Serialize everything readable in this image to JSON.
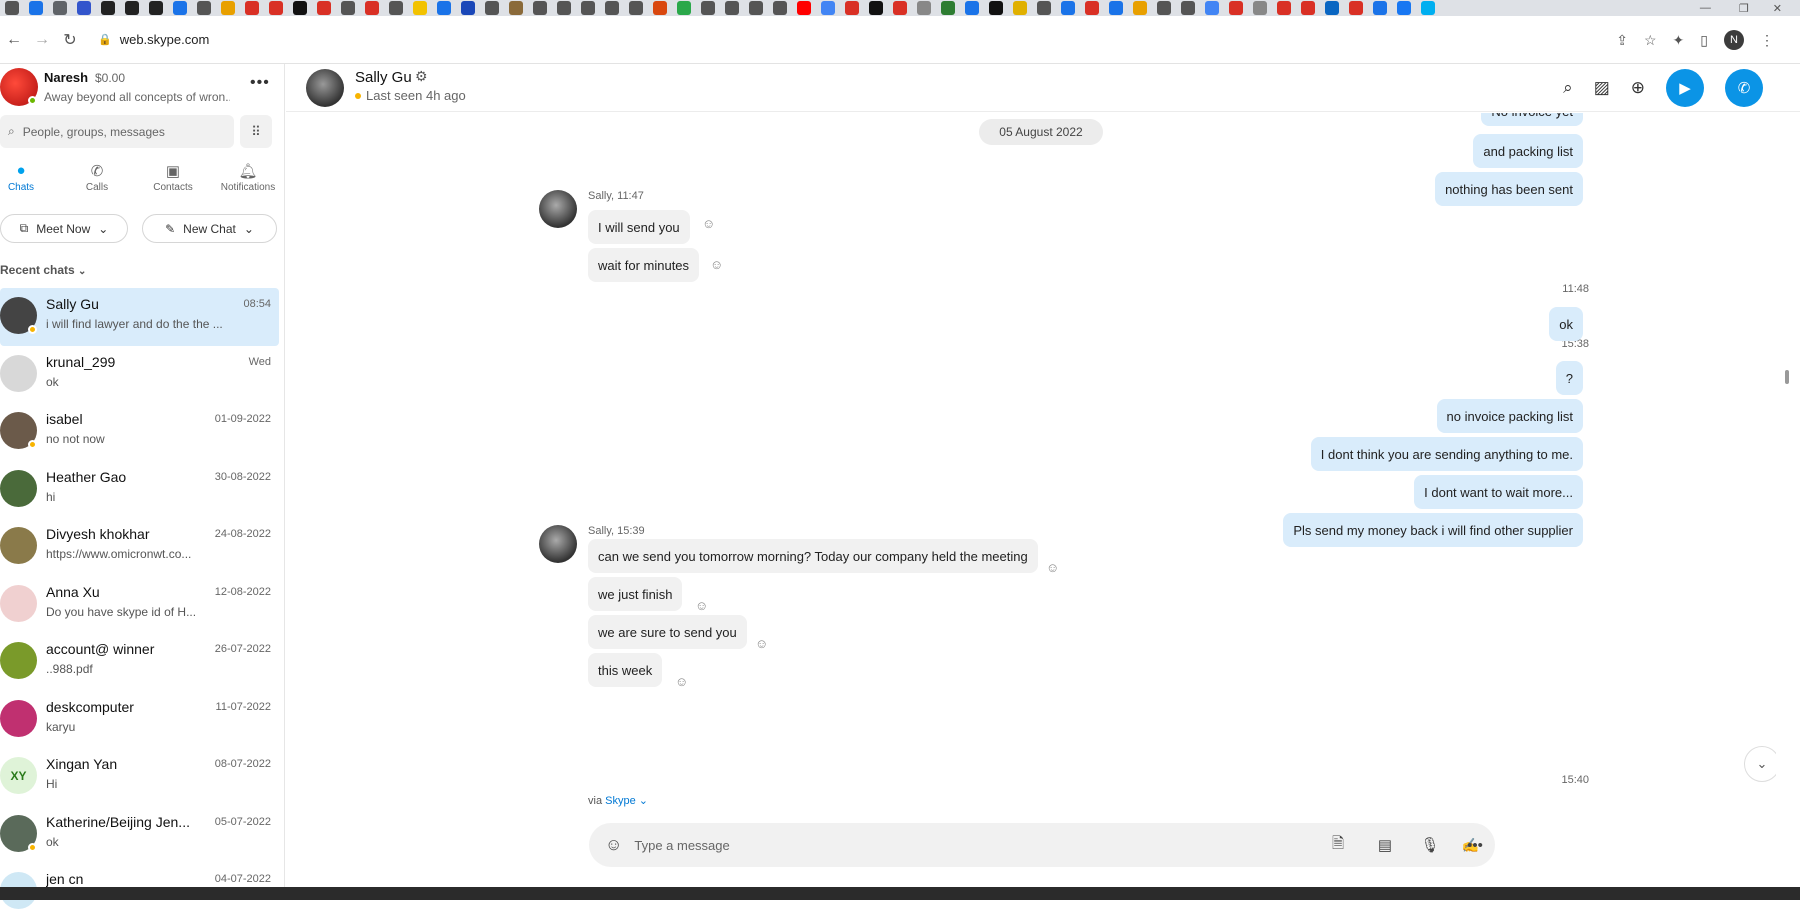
{
  "browser": {
    "url": "web.skype.com",
    "profile_initial": "N",
    "tab_icon_colors": [
      "#555555",
      "#1a73e8",
      "#5f6368",
      "#3355cc",
      "#222222",
      "#222222",
      "#222222",
      "#1a73e8",
      "#555555",
      "#e8a000",
      "#d93025",
      "#d93025",
      "#111111",
      "#d93025",
      "#555555",
      "#d93025",
      "#555555",
      "#f2c200",
      "#1a73e8",
      "#1a47b8",
      "#555555",
      "#8a6a3a",
      "#555555",
      "#555555",
      "#555555",
      "#555555",
      "#555555",
      "#d9480f",
      "#2aa84a",
      "#555555",
      "#555555",
      "#555555",
      "#555555",
      "#ff0000",
      "#4285f4",
      "#d93025",
      "#111111",
      "#d93025",
      "#888888",
      "#2e7d32",
      "#1a73e8",
      "#111111",
      "#e0b000",
      "#555555",
      "#1a73e8",
      "#d93025",
      "#1a73e8",
      "#e8a000",
      "#555555",
      "#555555",
      "#4285f4",
      "#d93025",
      "#888888",
      "#d93025",
      "#d93025",
      "#0a66c2",
      "#d93025",
      "#1a73e8",
      "#1877f2",
      "#00aff0"
    ]
  },
  "profile": {
    "name": "Naresh",
    "credit": "$0.00",
    "mood": "Away beyond all concepts of wron..."
  },
  "search": {
    "placeholder": "People, groups, messages"
  },
  "nav": {
    "chats": "Chats",
    "calls": "Calls",
    "contacts": "Contacts",
    "notifications": "Notifications"
  },
  "actions": {
    "meet_now": "Meet Now",
    "new_chat": "New Chat"
  },
  "recent_label": "Recent chats",
  "chats": [
    {
      "name": "Sally Gu",
      "date": "08:54",
      "preview": "i will find lawyer and do the the ...",
      "color": "#444444"
    },
    {
      "name": "krunal_299",
      "date": "Wed",
      "preview": "ok",
      "color": "#d8d8d8"
    },
    {
      "name": "isabel",
      "date": "01-09-2022",
      "preview": "no not now",
      "color": "#6b5a4a"
    },
    {
      "name": "Heather Gao",
      "date": "30-08-2022",
      "preview": "hi",
      "color": "#4a6a3a"
    },
    {
      "name": "Divyesh khokhar",
      "date": "24-08-2022",
      "preview": "https://www.omicronwt.co...",
      "color": "#8a7a4a"
    },
    {
      "name": "Anna Xu",
      "date": "12-08-2022",
      "preview": "Do you have skype id of H...",
      "color": "#f0d0d0"
    },
    {
      "name": "account@ winner",
      "date": "26-07-2022",
      "preview": "..988.pdf",
      "color": "#7a9a2a"
    },
    {
      "name": "deskcomputer",
      "date": "11-07-2022",
      "preview": "karyu",
      "color": "#c03070"
    },
    {
      "name": "Xingan  Yan",
      "date": "08-07-2022",
      "preview": "Hi",
      "color": "#dff3d8"
    },
    {
      "name": "Katherine/Beijing Jen...",
      "date": "05-07-2022",
      "preview": "ok",
      "color": "#5a6a5a"
    },
    {
      "name": "jen cn",
      "date": "04-07-2022",
      "preview": "",
      "color": "#cfe8f5"
    }
  ],
  "xy_initials": "XY",
  "header": {
    "name": "Sally Gu",
    "status": "Last seen 4h ago"
  },
  "conversation": {
    "date": "05 August 2022",
    "out1": [
      "No invoice yet",
      "and packing list",
      "nothing has been sent"
    ],
    "in1_meta": "Sally, 11:47",
    "in1": [
      "I will send you",
      "wait for minutes"
    ],
    "out2_time": "11:48",
    "out2": [
      "ok"
    ],
    "out3_time": "15:38",
    "out3": [
      "?",
      "no invoice packing list",
      "I dont think you are sending anything to me.",
      "I dont want to wait more...",
      "Pls send my money back i will find other supplier"
    ],
    "in2_meta": "Sally, 15:39",
    "in2": [
      "can we send you tomorrow morning? Today our company held the meeting",
      "we just finish",
      "we are sure to send you",
      "this week"
    ],
    "last_time": "15:40",
    "via_label": "via",
    "via_app": "Skype"
  },
  "composer": {
    "placeholder": "Type a message"
  }
}
